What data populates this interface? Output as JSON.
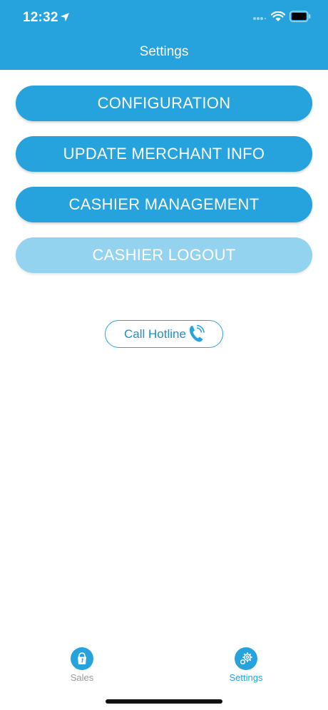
{
  "status_bar": {
    "time": "12:32",
    "icons": [
      "location-arrow-icon",
      "cellular-signal-icon",
      "wifi-icon",
      "battery-icon"
    ]
  },
  "header": {
    "title": "Settings",
    "background": "#26a3dc"
  },
  "menu": {
    "configuration_label": "CONFIGURATION",
    "update_merchant_label": "UPDATE MERCHANT INFO",
    "cashier_management_label": "CASHIER MANAGEMENT",
    "cashier_logout_label": "CASHIER LOGOUT",
    "cashier_logout_state": "disabled"
  },
  "hotline": {
    "label": "Call Hotline",
    "icon": "phone-icon"
  },
  "tab_bar": {
    "sales_label": "Sales",
    "sales_icon": "sales-bag-icon",
    "settings_label": "Settings",
    "settings_icon": "gear-icon",
    "active_tab": "Settings"
  },
  "colors": {
    "accent": "#26a3dc",
    "disabled_button": "#93d3f0",
    "inactive_tab_text": "#9a9a9a"
  }
}
